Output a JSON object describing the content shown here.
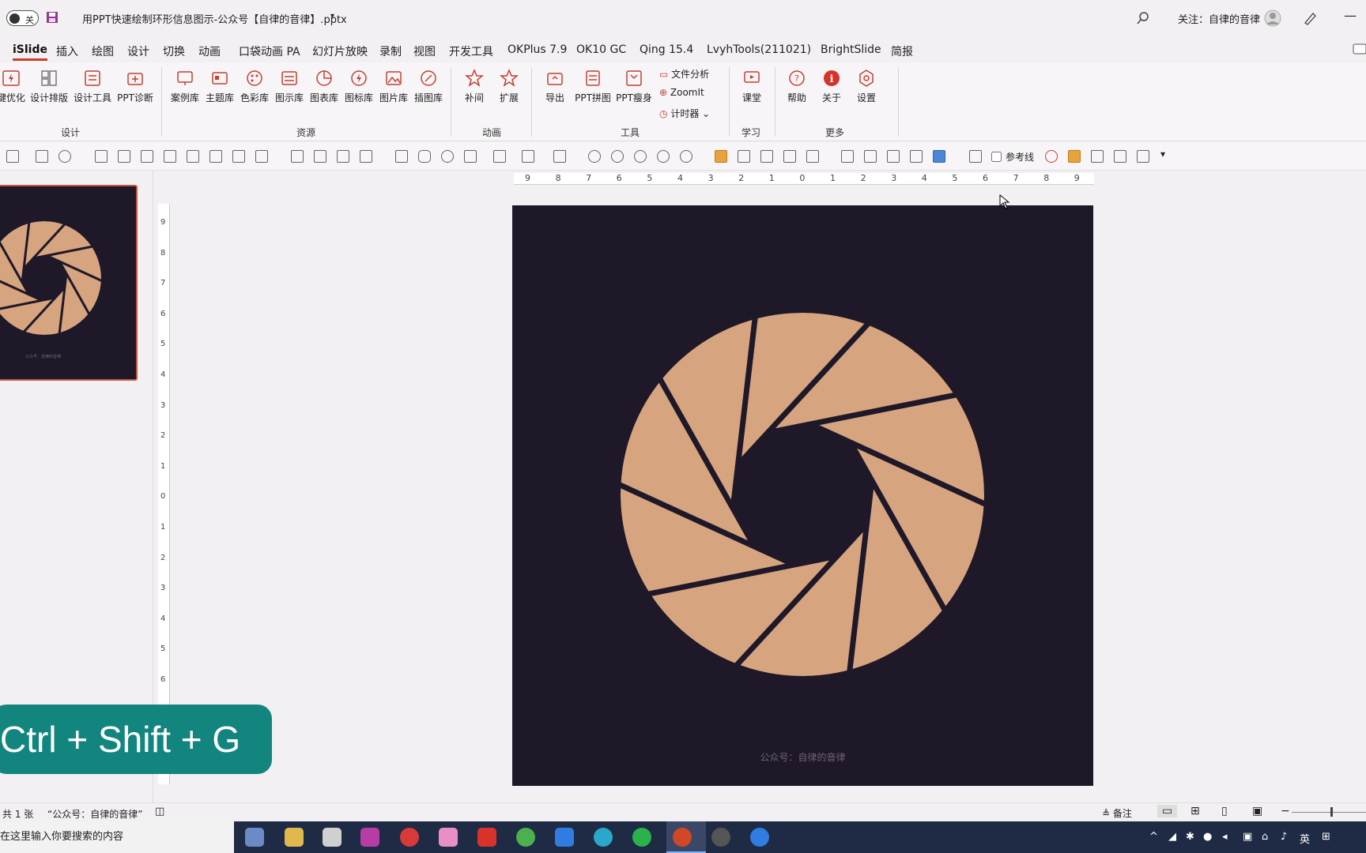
{
  "titlebar": {
    "toggle_label": "关",
    "doc_title": "用PPT快速绘制环形信息图示-公众号【自律的音律】.pptx",
    "follow_label": "关注：自律的音律"
  },
  "menu": [
    "iSlide",
    "插入",
    "绘图",
    "设计",
    "切换",
    "动画",
    "口袋动画 PA",
    "幻灯片放映",
    "录制",
    "视图",
    "开发工具",
    "OKPlus 7.9",
    "OK10 GC",
    "Qing 15.4",
    "LvyhTools(211021)",
    "BrightSlide",
    "简报"
  ],
  "ribbon": {
    "design_buttons": [
      "键优化",
      "设计排版",
      "设计工具",
      "PPT诊断"
    ],
    "resource_buttons": [
      "案例库",
      "主题库",
      "色彩库",
      "图示库",
      "图表库",
      "图标库",
      "图片库",
      "插图库"
    ],
    "animation_buttons": [
      "补间",
      "扩展"
    ],
    "tool_buttons": [
      "导出",
      "PPT拼图",
      "PPT瘦身"
    ],
    "tool_small": [
      "文件分析",
      "ZoomIt",
      "计时器"
    ],
    "learn_buttons": [
      "课堂"
    ],
    "more_buttons": [
      "帮助",
      "关于",
      "设置"
    ],
    "groups": [
      "设计",
      "资源",
      "动画",
      "工具",
      "学习",
      "更多"
    ]
  },
  "toolbar2": {
    "ref_line_label": "参考线"
  },
  "ruler_top_labels": [
    "9",
    "8",
    "7",
    "6",
    "5",
    "4",
    "3",
    "2",
    "1",
    "0",
    "1",
    "2",
    "3",
    "4",
    "5",
    "6",
    "7",
    "8",
    "9"
  ],
  "ruler_left_labels": [
    "9",
    "8",
    "7",
    "6",
    "5",
    "4",
    "3",
    "2",
    "1",
    "0",
    "1",
    "2",
    "3",
    "4",
    "5",
    "6"
  ],
  "slide": {
    "watermark": "公众号：自律的音律",
    "thumb_watermark": "公众号：自律的音律"
  },
  "shortcut": "Ctrl + Shift + G",
  "status": {
    "slide_count": "共 1 张",
    "theme": "“公众号：自律的音律”",
    "notes": "备注"
  },
  "taskbar": {
    "search_placeholder": "在这里输入你要搜索的内容",
    "ime": "英"
  },
  "colors": {
    "slide_bg": "#1e1829",
    "aperture": "#d6a47e",
    "accent": "#c4402f",
    "shortcut_bg": "#13857f"
  }
}
